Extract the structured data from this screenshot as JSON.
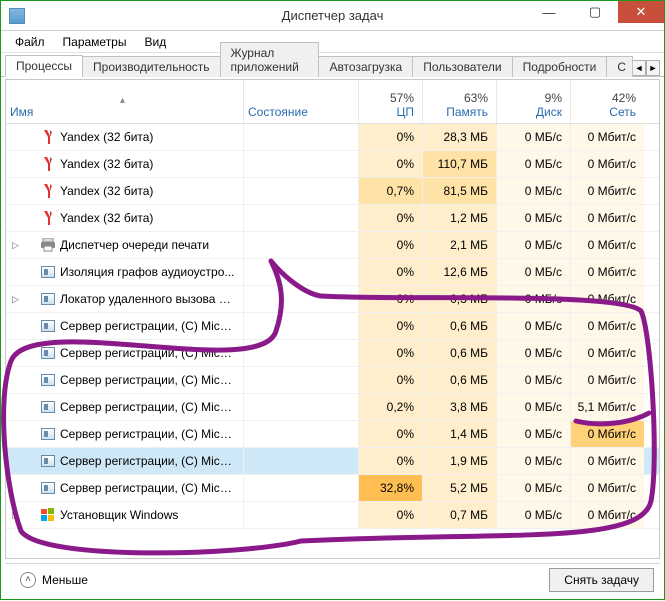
{
  "window": {
    "title": "Диспетчер задач"
  },
  "menu": {
    "file": "Файл",
    "options": "Параметры",
    "view": "Вид"
  },
  "tabs": [
    {
      "key": "processes",
      "label": "Процессы",
      "active": true
    },
    {
      "key": "performance",
      "label": "Производительность",
      "active": false
    },
    {
      "key": "app_history",
      "label": "Журнал приложений",
      "active": false
    },
    {
      "key": "startup",
      "label": "Автозагрузка",
      "active": false
    },
    {
      "key": "users",
      "label": "Пользователи",
      "active": false
    },
    {
      "key": "details",
      "label": "Подробности",
      "active": false
    },
    {
      "key": "services",
      "label": "С",
      "active": false
    }
  ],
  "columns": {
    "name": {
      "label": "Имя"
    },
    "state": {
      "label": "Состояние"
    },
    "cpu": {
      "label": "ЦП",
      "pct": "57%"
    },
    "mem": {
      "label": "Память",
      "pct": "63%"
    },
    "disk": {
      "label": "Диск",
      "pct": "9%"
    },
    "net": {
      "label": "Сеть",
      "pct": "42%"
    }
  },
  "heat": {
    "cpu_cells": [
      "h1",
      "h1",
      "h2",
      "h1",
      "h1",
      "h1",
      "h1",
      "h1",
      "h1",
      "h1",
      "h1",
      "h1",
      "h1",
      "h4",
      "h1"
    ],
    "mem_cells": [
      "h1",
      "h2",
      "h2",
      "h1",
      "h1",
      "h1",
      "h1",
      "h1",
      "h1",
      "h1",
      "h1",
      "h1",
      "h1",
      "h1",
      "h1"
    ],
    "disk_cells": [
      "h0",
      "h0",
      "h0",
      "h0",
      "h0",
      "h0",
      "h0",
      "h0",
      "h0",
      "h0",
      "h0",
      "h0",
      "h0",
      "h0",
      "h0"
    ],
    "net_cells": [
      "h0",
      "h0",
      "h0",
      "h0",
      "h0",
      "h0",
      "h0",
      "h0",
      "h0",
      "h0",
      "h0",
      "h3",
      "h0",
      "h0",
      "h0"
    ]
  },
  "rows": [
    {
      "exp": "",
      "icon": "yandex",
      "name": "Yandex (32 бита)",
      "cpu": "0%",
      "mem": "28,3 МБ",
      "disk": "0 МБ/с",
      "net": "0 Мбит/с",
      "sel": false
    },
    {
      "exp": "",
      "icon": "yandex",
      "name": "Yandex (32 бита)",
      "cpu": "0%",
      "mem": "110,7 МБ",
      "disk": "0 МБ/с",
      "net": "0 Мбит/с",
      "sel": false
    },
    {
      "exp": "",
      "icon": "yandex",
      "name": "Yandex (32 бита)",
      "cpu": "0,7%",
      "mem": "81,5 МБ",
      "disk": "0 МБ/с",
      "net": "0 Мбит/с",
      "sel": false
    },
    {
      "exp": "",
      "icon": "yandex",
      "name": "Yandex (32 бита)",
      "cpu": "0%",
      "mem": "1,2 МБ",
      "disk": "0 МБ/с",
      "net": "0 Мбит/с",
      "sel": false
    },
    {
      "exp": "▷",
      "icon": "printer",
      "name": "Диспетчер очереди печати",
      "cpu": "0%",
      "mem": "2,1 МБ",
      "disk": "0 МБ/с",
      "net": "0 Мбит/с",
      "sel": false
    },
    {
      "exp": "",
      "icon": "svc",
      "name": "Изоляция графов аудиоустро...",
      "cpu": "0%",
      "mem": "12,6 МБ",
      "disk": "0 МБ/с",
      "net": "0 Мбит/с",
      "sel": false
    },
    {
      "exp": "▷",
      "icon": "svc",
      "name": "Локатор удаленного вызова п...",
      "cpu": "0%",
      "mem": "0,3 МБ",
      "disk": "0 МБ/с",
      "net": "0 Мбит/с",
      "sel": false
    },
    {
      "exp": "",
      "icon": "svc",
      "name": "Сервер регистрации, (C) Micro...",
      "cpu": "0%",
      "mem": "0,6 МБ",
      "disk": "0 МБ/с",
      "net": "0 Мбит/с",
      "sel": false
    },
    {
      "exp": "",
      "icon": "svc",
      "name": "Сервер регистрации, (C) Micro...",
      "cpu": "0%",
      "mem": "0,6 МБ",
      "disk": "0 МБ/с",
      "net": "0 Мбит/с",
      "sel": false
    },
    {
      "exp": "",
      "icon": "svc",
      "name": "Сервер регистрации, (C) Micro...",
      "cpu": "0%",
      "mem": "0,6 МБ",
      "disk": "0 МБ/с",
      "net": "0 Мбит/с",
      "sel": false
    },
    {
      "exp": "",
      "icon": "svc",
      "name": "Сервер регистрации, (C) Micro...",
      "cpu": "0,2%",
      "mem": "3,8 МБ",
      "disk": "0 МБ/с",
      "net": "5,1 Мбит/с",
      "sel": false
    },
    {
      "exp": "",
      "icon": "svc",
      "name": "Сервер регистрации, (C) Micro...",
      "cpu": "0%",
      "mem": "1,4 МБ",
      "disk": "0 МБ/с",
      "net": "0 Мбит/с",
      "sel": false
    },
    {
      "exp": "",
      "icon": "svc",
      "name": "Сервер регистрации, (C) Micro...",
      "cpu": "0%",
      "mem": "1,9 МБ",
      "disk": "0 МБ/с",
      "net": "0 Мбит/с",
      "sel": true
    },
    {
      "exp": "",
      "icon": "svc",
      "name": "Сервер регистрации, (C) Micro...",
      "cpu": "32,8%",
      "mem": "5,2 МБ",
      "disk": "0 МБ/с",
      "net": "0 Мбит/с",
      "sel": false
    },
    {
      "exp": "▷",
      "icon": "win",
      "name": "Установщик Windows",
      "cpu": "0%",
      "mem": "0,7 МБ",
      "disk": "0 МБ/с",
      "net": "0 Мбит/с",
      "sel": false
    }
  ],
  "bottom": {
    "fewer": "Меньше",
    "end_task": "Снять задачу"
  }
}
